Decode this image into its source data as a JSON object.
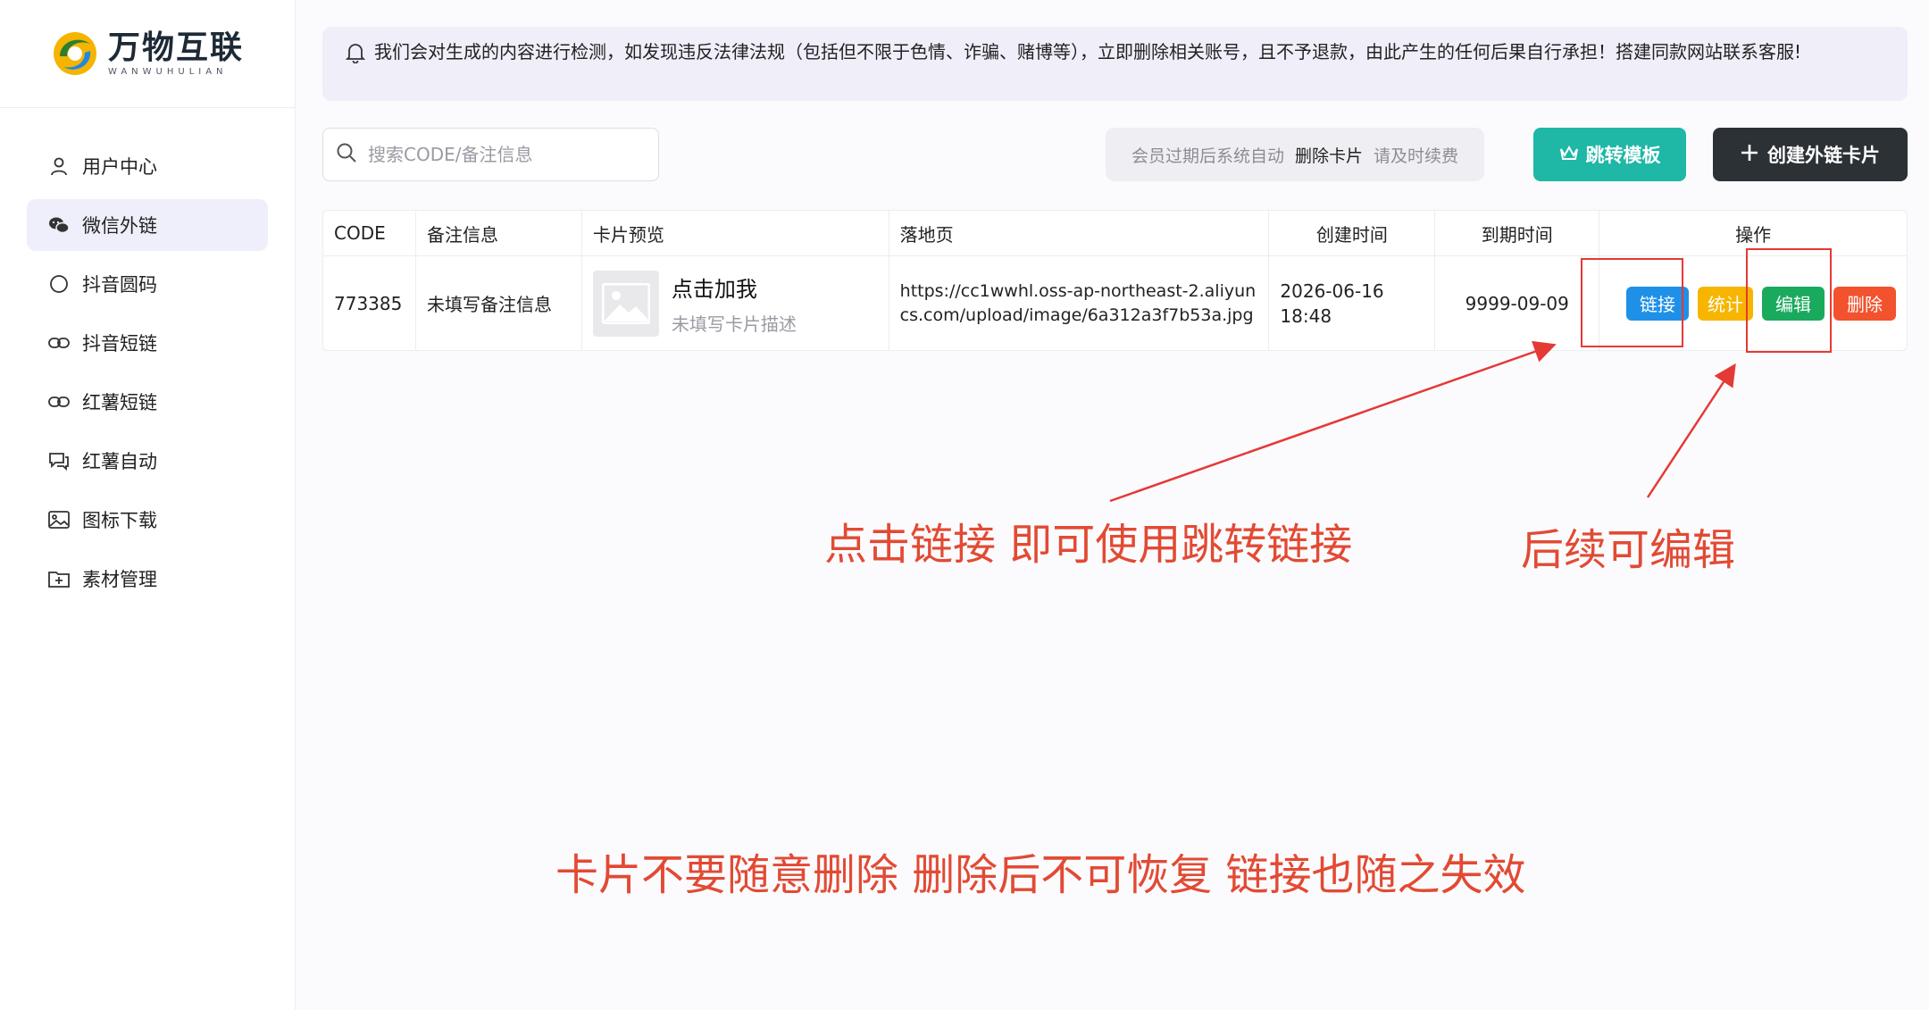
{
  "brand": {
    "title": "万物互联",
    "subtitle": "WANWUHULIAN"
  },
  "sidebar": {
    "items": [
      {
        "label": "用户中心",
        "icon": "user-icon"
      },
      {
        "label": "微信外链",
        "icon": "wechat-icon",
        "active": true
      },
      {
        "label": "抖音圆码",
        "icon": "circle-icon"
      },
      {
        "label": "抖音短链",
        "icon": "link-icon"
      },
      {
        "label": "红薯短链",
        "icon": "link-icon"
      },
      {
        "label": "红薯自动",
        "icon": "chat-icon"
      },
      {
        "label": "图标下载",
        "icon": "image-icon"
      },
      {
        "label": "素材管理",
        "icon": "folder-plus-icon"
      }
    ]
  },
  "notice": {
    "icon": "bell-icon",
    "text": "我们会对生成的内容进行检测，如发现违反法律法规（包括但不限于色情、诈骗、赌博等），立即删除相关账号，且不予退款，由此产生的任何后果自行承担！搭建同款网站联系客服!"
  },
  "toolbar": {
    "search_placeholder": "搜索CODE/备注信息",
    "expire_tip_1": "会员过期后系统自动",
    "expire_tip_2": "删除卡片",
    "expire_tip_3": "请及时续费",
    "template_label": "跳转模板",
    "create_label": "创建外链卡片"
  },
  "table": {
    "headers": [
      "CODE",
      "备注信息",
      "卡片预览",
      "落地页",
      "创建时间",
      "到期时间",
      "操作"
    ],
    "rows": [
      {
        "code": "773385",
        "remark": "未填写备注信息",
        "card_title": "点击加我",
        "card_desc": "未填写卡片描述",
        "landing": "https://cc1wwhl.oss-ap-northeast-2.aliyuncs.com/upload/image/6a312a3f7b53a.jpg",
        "created_date": "2026-06-16",
        "created_time": "18:48",
        "expire": "9999-09-09",
        "actions": {
          "link": "链接",
          "stat": "统计",
          "edit": "编辑",
          "delete": "删除"
        }
      }
    ]
  },
  "annotations": {
    "link_hint": "点击链接 即可使用跳转链接",
    "edit_hint": "后续可编辑",
    "delete_warning": "卡片不要随意删除 删除后不可恢复 链接也随之失效"
  },
  "colors": {
    "accent_teal": "#1fb7a6",
    "dark_button": "#2c3136",
    "link_blue": "#1e90e8",
    "stat_yellow": "#f7b500",
    "edit_green": "#1aaa5e",
    "delete_red": "#f2522d",
    "annotation_red": "#e24a33"
  }
}
